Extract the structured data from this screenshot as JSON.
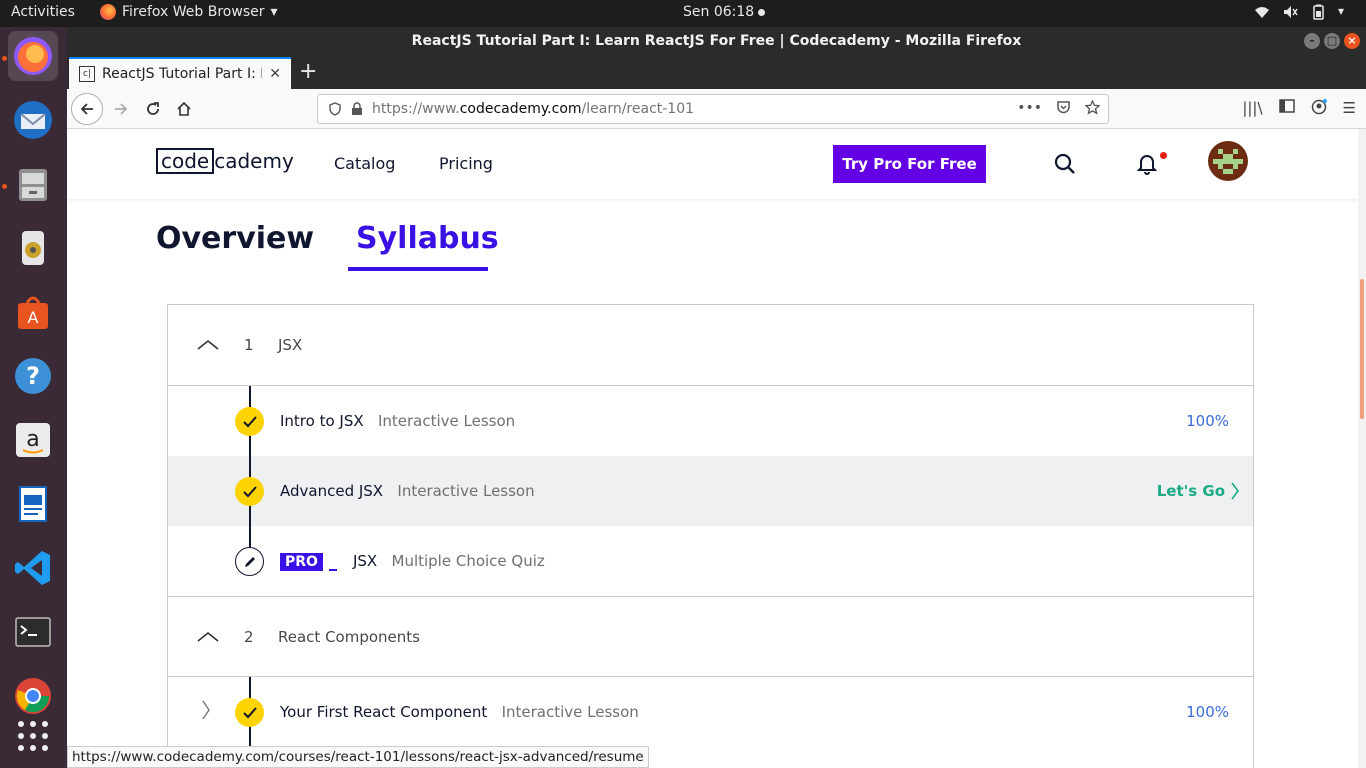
{
  "topbar": {
    "activities": "Activities",
    "app_name": "Firefox Web Browser",
    "clock": "Sen 06:18"
  },
  "window": {
    "title": "ReactJS Tutorial Part I: Learn ReactJS For Free | Codecademy - Mozilla Firefox"
  },
  "tab": {
    "title": "ReactJS Tutorial Part I: Learn ReactJS For Free",
    "favicon": "c|"
  },
  "navbar": {
    "url_prefix": "https://www.",
    "url_domain": "codecademy.com",
    "url_path": "/learn/react-101"
  },
  "header": {
    "logo_a": "code",
    "logo_b": "cademy",
    "nav_catalog": "Catalog",
    "nav_pricing": "Pricing",
    "try_pro": "Try Pro For Free"
  },
  "tabs": {
    "overview": "Overview",
    "syllabus": "Syllabus"
  },
  "modules": [
    {
      "number": "1",
      "name": "JSX"
    },
    {
      "number": "2",
      "name": "React Components"
    }
  ],
  "lessons": [
    {
      "name": "Intro to JSX",
      "type": "Interactive Lesson",
      "progress": "100%"
    },
    {
      "name": "Advanced JSX",
      "type": "Interactive Lesson",
      "action": "Let's Go"
    },
    {
      "pro_badge": "PRO",
      "name": "JSX",
      "type": "Multiple Choice Quiz"
    },
    {
      "name": "Your First React Component",
      "type": "Interactive Lesson",
      "progress": "100%"
    }
  ],
  "status_url": "https://www.codecademy.com/courses/react-101/lessons/react-jsx-advanced/resume",
  "colors": {
    "accent": "#3a10e5",
    "pro_button": "#6400e4",
    "check": "#ffd300",
    "go": "#1aab85",
    "progress": "#3a6cd8"
  }
}
